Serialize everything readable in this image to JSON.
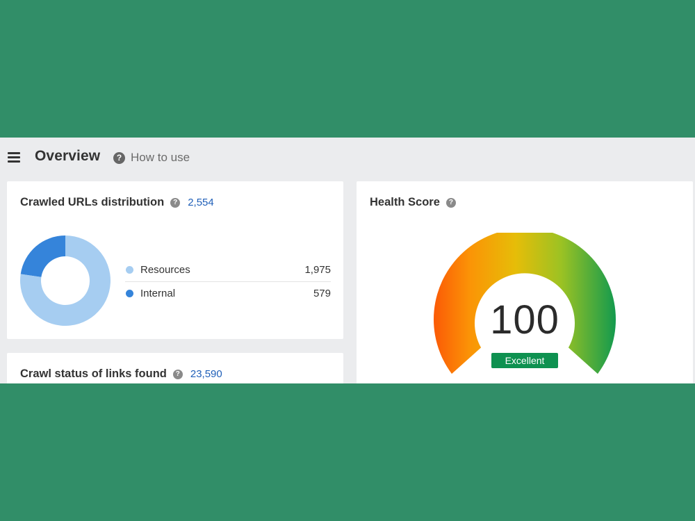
{
  "header": {
    "title": "Overview",
    "help_label": "How to use",
    "help_icon": "?"
  },
  "crawled_urls": {
    "title": "Crawled URLs distribution",
    "help_icon": "?",
    "total": "2,554",
    "items": [
      {
        "label": "Resources",
        "value": "1,975",
        "color": "#a6cdf1"
      },
      {
        "label": "Internal",
        "value": "579",
        "color": "#3584da"
      }
    ]
  },
  "crawl_status": {
    "title": "Crawl status of links found",
    "help_icon": "?",
    "total": "23,590"
  },
  "health": {
    "title": "Health Score",
    "help_icon": "?",
    "score": "100",
    "rating": "Excellent",
    "rating_color": "#0e9150"
  },
  "chart_data": {
    "type": "pie",
    "categories": [
      "Resources",
      "Internal"
    ],
    "values": [
      1975,
      579
    ],
    "colors": [
      "#a6cdf1",
      "#3584da"
    ]
  }
}
